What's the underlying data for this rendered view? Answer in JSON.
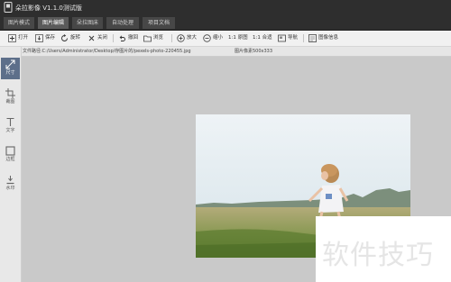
{
  "app": {
    "title": "朵拉影像 V1.1.0测试版"
  },
  "tabs": [
    {
      "label": "图片模式",
      "active": false
    },
    {
      "label": "图片编辑",
      "active": true
    },
    {
      "label": "朵拉图床",
      "active": false
    },
    {
      "label": "自动处理",
      "active": false
    },
    {
      "label": "项目文档",
      "active": false
    }
  ],
  "toolbar": {
    "open": "打开",
    "save": "保存",
    "rotate": "旋转",
    "close": "关闭",
    "undo": "撤回",
    "browse": "浏览",
    "zoom_in": "放大",
    "zoom_out": "缩小",
    "original": "1:1 原图",
    "fit": "1:1 合适",
    "navigator": "导航",
    "image_info": "图像信息"
  },
  "pathbar": {
    "file_path": "文件路径:C:/Users/Administrator/Desktop/存图片的/pexels-photo-220455.jpg",
    "image_size": "图片像素500x333"
  },
  "sidebar": [
    {
      "label": "尺寸",
      "icon": "resize-icon",
      "active": true
    },
    {
      "label": "裁图",
      "icon": "crop-icon",
      "active": false
    },
    {
      "label": "文字",
      "icon": "text-icon",
      "active": false
    },
    {
      "label": "边框",
      "icon": "border-icon",
      "active": false
    },
    {
      "label": "水印",
      "icon": "watermark-icon",
      "active": false
    }
  ],
  "watermark": {
    "text": "软件技巧"
  },
  "colors": {
    "titlebar": "#2e2e2e",
    "toolbar": "#f1f1f1",
    "canvas": "#c9c9c9",
    "sidebar_active": "#5d6f8a"
  }
}
